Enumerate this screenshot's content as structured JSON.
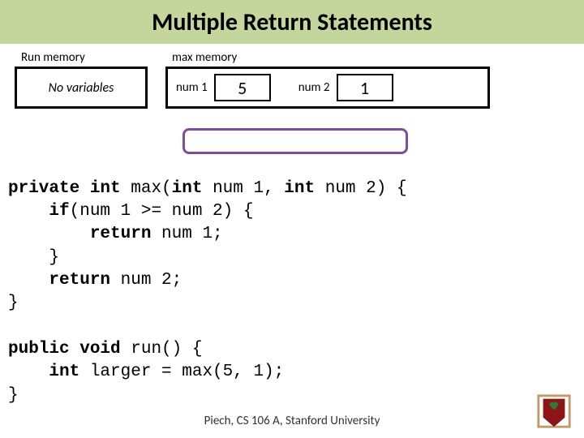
{
  "title": "Multiple Return Statements",
  "memory": {
    "run": {
      "label": "Run memory",
      "content": "No variables"
    },
    "max": {
      "label": "max memory",
      "vars": [
        {
          "name": "num 1",
          "value": "5"
        },
        {
          "name": "num 2",
          "value": "1"
        }
      ]
    }
  },
  "code": {
    "line1_a": "private int ",
    "line1_b": "max",
    "line1_c": "(",
    "line1_d": "int ",
    "line1_e": "num 1, ",
    "line1_f": "int ",
    "line1_g": "num 2",
    "line1_h": ") {",
    "line2_a": "    if",
    "line2_b": "(num 1 >= num 2) {",
    "line3_a": "        return ",
    "line3_b": "num 1;",
    "line4": "    }",
    "line5_a": "    return ",
    "line5_b": "num 2;",
    "line6": "}",
    "line7_a": "public void ",
    "line7_b": "run",
    "line7_c": "() {",
    "line8_a": "    int ",
    "line8_b": "larger = max(5, 1);",
    "line9": "}"
  },
  "footer": "Piech, CS 106 A, Stanford University",
  "logo": {
    "fill": "#8c1515",
    "frame": "#c19a6b"
  }
}
